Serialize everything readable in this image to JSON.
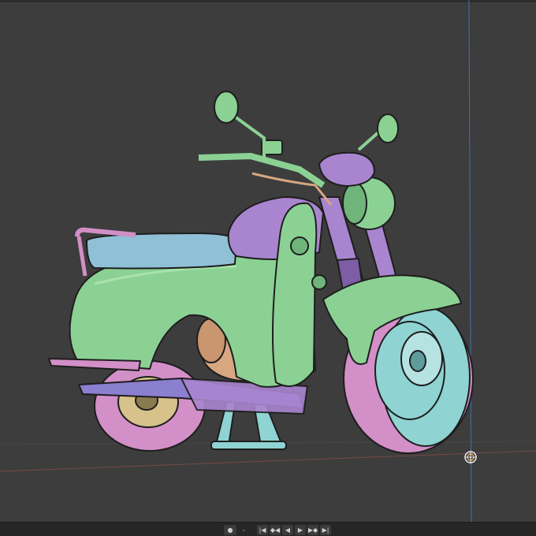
{
  "viewport": {
    "background": "#3d3d3d",
    "object": "motorcycle",
    "palette": {
      "body_green": "#8bd194",
      "body_green_shadow": "#6fb57b",
      "accent_purple": "#a985cf",
      "accent_purple_dark": "#7c5da6",
      "seat_blue": "#8fc0d6",
      "wheel_pink": "#d38fc7",
      "rim_cyan": "#8fd3d3",
      "engine_tan": "#d6a781",
      "outline": "#1e1e1e"
    },
    "world_origin_icon": "origin-gizmo-icon"
  },
  "timeline": {
    "buttons": [
      {
        "icon": "record-icon",
        "glyph": "●"
      },
      {
        "icon": "chevron-down-icon",
        "glyph": "⌄"
      },
      {
        "icon": "jump-start-icon",
        "glyph": "|◀"
      },
      {
        "icon": "prev-keyframe-icon",
        "glyph": "◆◀"
      },
      {
        "icon": "play-reverse-icon",
        "glyph": "◀"
      },
      {
        "icon": "play-icon",
        "glyph": "▶"
      },
      {
        "icon": "next-keyframe-icon",
        "glyph": "▶◆"
      },
      {
        "icon": "jump-end-icon",
        "glyph": "▶|"
      }
    ]
  }
}
